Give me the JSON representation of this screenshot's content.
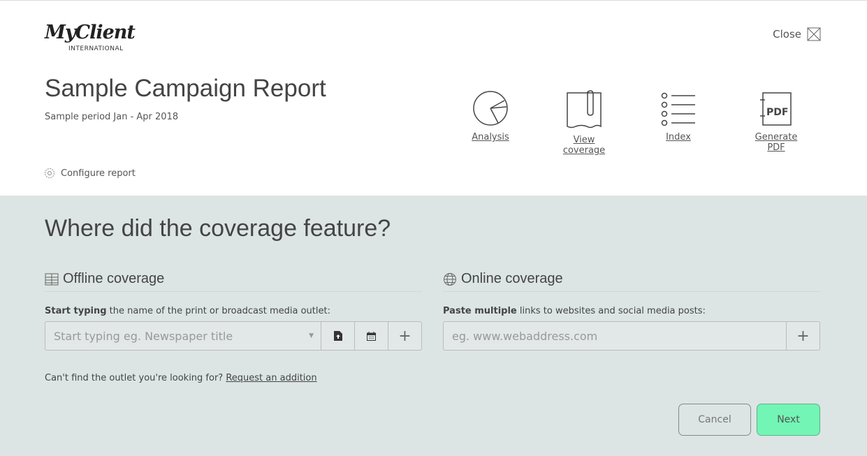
{
  "logo": {
    "name": "MyClient",
    "sub": "INTERNATIONAL"
  },
  "header": {
    "close_label": "Close",
    "title": "Sample Campaign Report",
    "period": "Sample period Jan - Apr 2018",
    "configure": "Configure report"
  },
  "actions": [
    {
      "label": "Analysis",
      "icon": "pie-chart-icon"
    },
    {
      "label": "View coverage",
      "icon": "clipped-page-icon"
    },
    {
      "label": "Index",
      "icon": "list-icon"
    },
    {
      "label": "Generate PDF",
      "icon": "pdf-icon",
      "icon_text": "PDF"
    }
  ],
  "main": {
    "question": "Where did the coverage feature?",
    "offline": {
      "heading": "Offline coverage",
      "label_bold": "Start typing",
      "label_rest": " the name of the print or broadcast media outlet:",
      "placeholder": "Start typing eg. Newspaper title",
      "add": "+"
    },
    "online": {
      "heading": "Online coverage",
      "label_bold": "Paste multiple",
      "label_rest": " links to websites and social media posts:",
      "placeholder": "eg. www.webaddress.com",
      "add": "+"
    },
    "help_text": "Can't find the outlet you're looking for? ",
    "help_link": "Request an addition",
    "cancel": "Cancel",
    "next": "Next"
  },
  "colors": {
    "panel": "#dce5e3",
    "next": "#72f5b5"
  }
}
